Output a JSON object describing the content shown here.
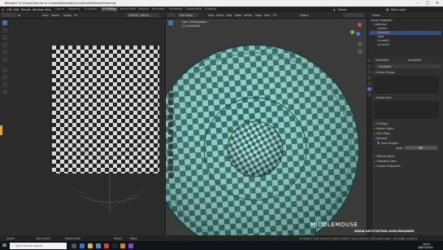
{
  "window": {
    "title": "Blender* [C:\\Users\\Vlsa de la Cumbre\\Desktop\\Curso\\Shield\\Tutorial3.blend]"
  },
  "menu": {
    "items": [
      "File",
      "Edit",
      "Render",
      "Window",
      "Help"
    ],
    "workspaces": [
      "Layout",
      "Modeling",
      "Sculpting",
      "UV Editing",
      "Texture Paint",
      "Shading",
      "Animation",
      "Rendering",
      "Compositing",
      "Scripting"
    ],
    "active_workspace": "UV Editing",
    "scene": "Scene",
    "view_layer": "View Layer"
  },
  "uv_editor": {
    "header": {
      "mode_items": [
        "View",
        "Select",
        "Image",
        "UV"
      ],
      "image_name": "PSIONE_CHECK..."
    }
  },
  "viewport": {
    "header": {
      "mode": "Edit Mode",
      "menu": [
        "View",
        "Select",
        "Add",
        "Mesh",
        "Vertex",
        "Edge",
        "Face",
        "UV"
      ],
      "orientation": "Global"
    },
    "info_line1": "User Orthographic",
    "info_line2": "(1) Circle004",
    "watermark": "MIDDLEMOUSE"
  },
  "outliner": {
    "header": "Scene",
    "rows": [
      {
        "label": "Scene Collection",
        "indent": 0,
        "selected": false
      },
      {
        "label": "Collection",
        "indent": 1,
        "selected": false
      },
      {
        "label": "Camera",
        "indent": 2,
        "selected": false
      },
      {
        "label": "Circle004",
        "indent": 2,
        "selected": true
      },
      {
        "label": "Light",
        "indent": 2,
        "selected": false
      },
      {
        "label": "Circle001",
        "indent": 2,
        "selected": false
      },
      {
        "label": "Circle003",
        "indent": 2,
        "selected": false
      }
    ]
  },
  "properties": {
    "object_name": "Circle004",
    "mesh_name": "Circle004",
    "sections": [
      "Vertex Groups",
      "Shape Keys",
      "UV Maps",
      "Vertex Colors",
      "Face Maps",
      "Normals",
      "Texture Space",
      "Geometry Data",
      "Custom Properties"
    ],
    "normals": {
      "auto_smooth_label": "Auto Smooth",
      "angle_label": "Angle",
      "angle_value": "30°"
    }
  },
  "status_bar": {
    "left_items": [
      "Select",
      "Box Select",
      "Rotate View",
      "Select",
      "Move"
    ],
    "right_text": "Circle004 | Verts 5/4,916 | Edges 5/9,824 | Faces 0/4,912 | Tris 9,824 | Mem: 132.6 MB | v2.80.74"
  },
  "watermark_site": "WWW.ARTSTATION.COM/MIRABEN",
  "taskbar": {
    "search_placeholder": "Type here to search",
    "time": "10:47",
    "date": "28/07/2019"
  },
  "colors": {
    "accent": "#4772b3",
    "selected_row": "#334d80",
    "orange_sel": "#f0a030"
  }
}
